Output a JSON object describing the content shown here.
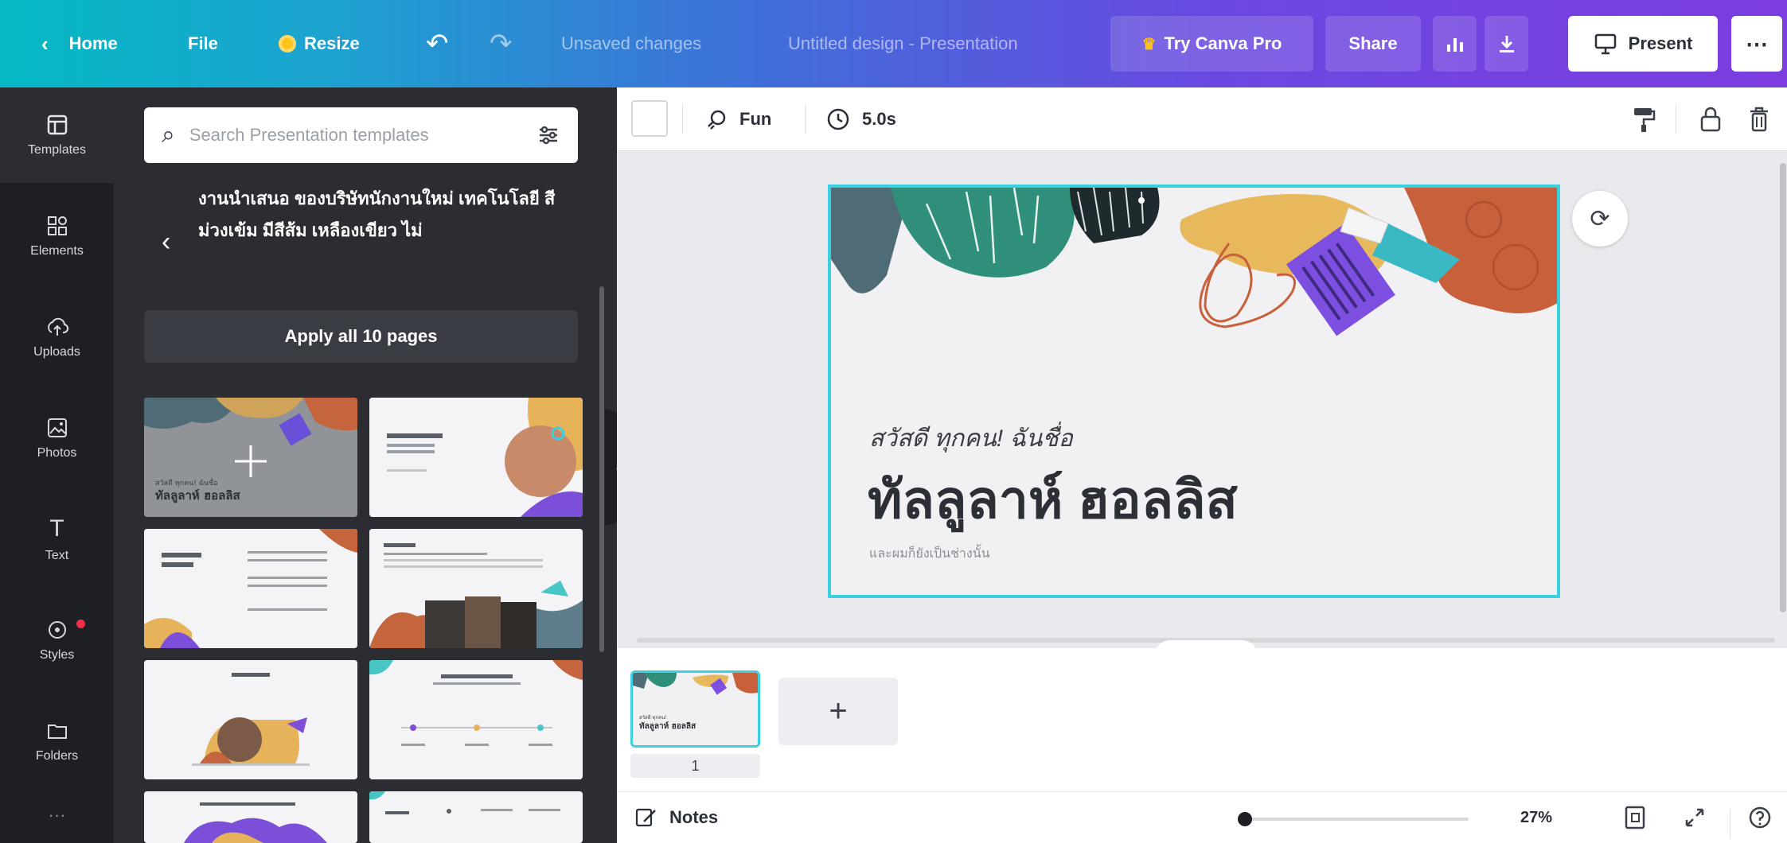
{
  "topbar": {
    "home": "Home",
    "file": "File",
    "resize": "Resize",
    "unsaved": "Unsaved changes",
    "doc_title": "Untitled design - Presentation",
    "try_pro": "Try Canva Pro",
    "share": "Share",
    "present": "Present",
    "more": "⋯"
  },
  "rail": {
    "items": [
      {
        "label": "Templates",
        "icon": "templates-icon",
        "active": true
      },
      {
        "label": "Elements",
        "icon": "elements-icon"
      },
      {
        "label": "Uploads",
        "icon": "uploads-icon"
      },
      {
        "label": "Photos",
        "icon": "photos-icon"
      },
      {
        "label": "Text",
        "icon": "text-icon"
      },
      {
        "label": "Styles",
        "icon": "styles-icon",
        "badge": true
      },
      {
        "label": "Folders",
        "icon": "folders-icon"
      },
      {
        "label": "···",
        "icon": "more-apps-icon"
      }
    ]
  },
  "panel": {
    "search_placeholder": "Search Presentation templates",
    "template_description": "งานนำเสนอ ของบริษัทนักงานใหม่ เทคโนโลยี สีม่วงเข้ม มีสีส้ม เหลืองเขียว ไม่",
    "apply_button": "Apply all 10 pages"
  },
  "toolbar": {
    "fun": "Fun",
    "duration": "5.0s"
  },
  "slide": {
    "greeting": "สวัสดี ทุกคน! ฉันชื่อ",
    "name": "ทัลลูลาห์ ฮอลลิส",
    "small_text": "และผมก็ยังเป็นช่างนั้น"
  },
  "pages": {
    "current_number": "1",
    "add_page": "+"
  },
  "footer": {
    "notes": "Notes",
    "zoom": "27%",
    "zoom_fraction": 0.03
  },
  "colors": {
    "accent": "#3ad0e0",
    "rail_bg": "#1d1f24",
    "panel_bg": "#2b2d33",
    "topbar_start": "#05b9c4",
    "topbar_end": "#7c3de0"
  }
}
